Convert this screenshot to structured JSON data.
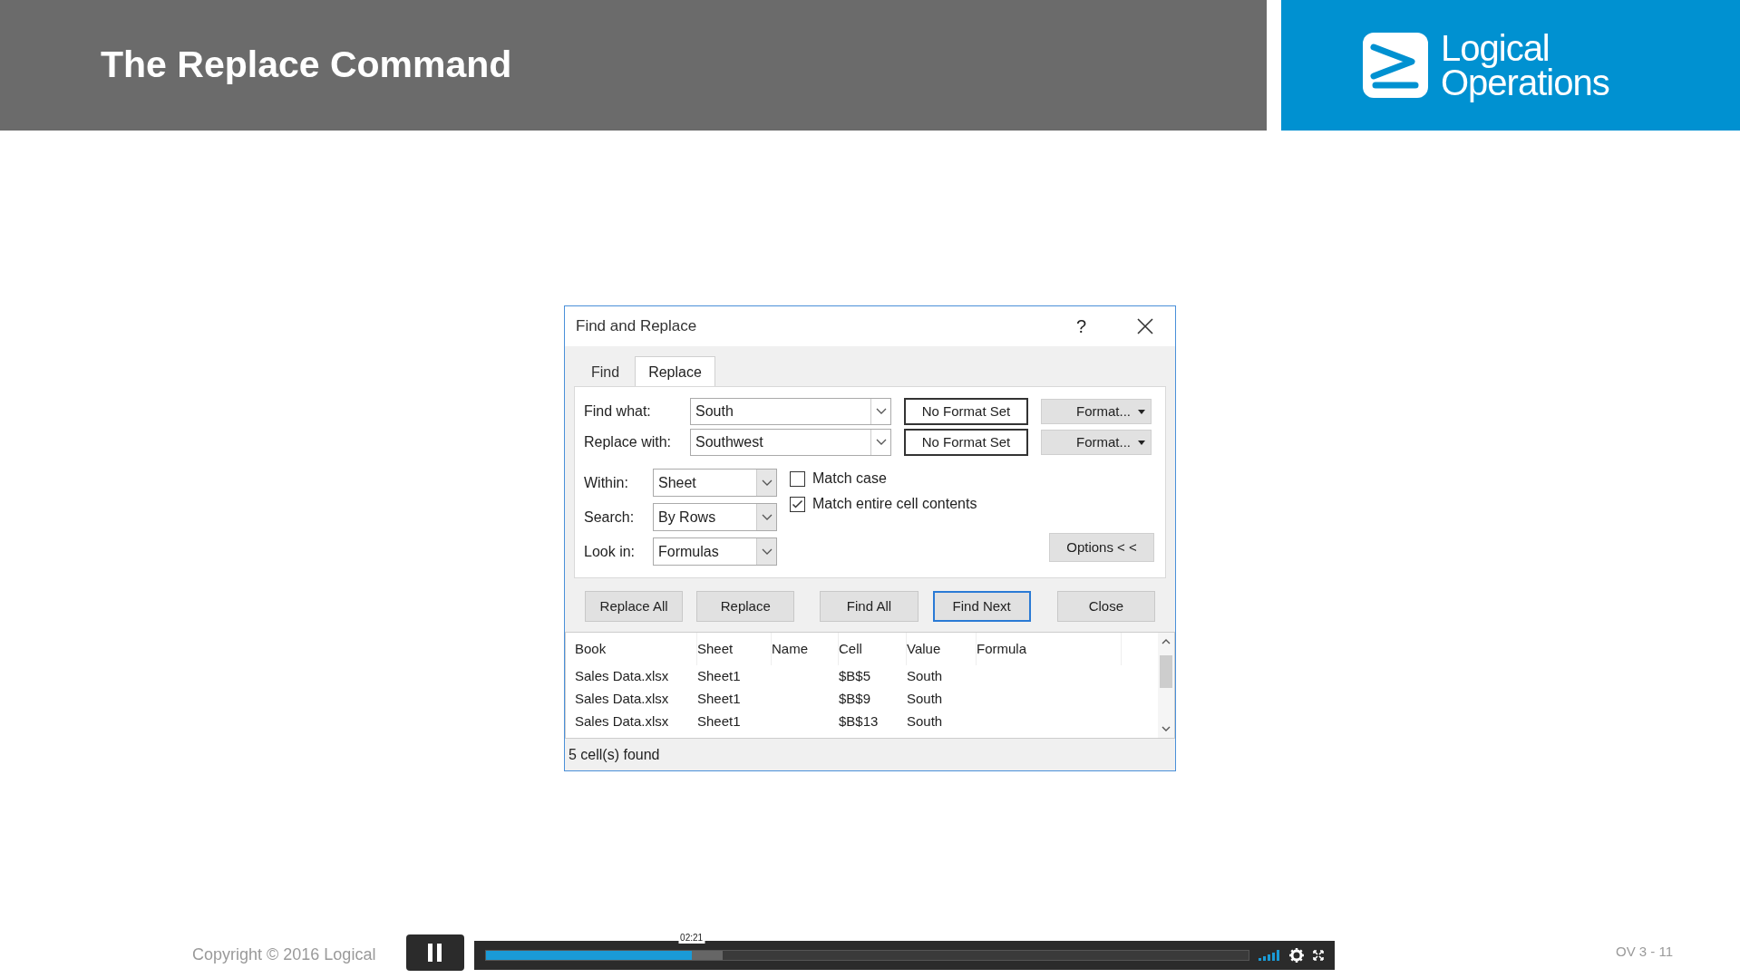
{
  "slide": {
    "title": "The Replace Command",
    "logo_lines": [
      "Logical",
      "Operations"
    ],
    "copyright": "Copyright © 2016 Logical",
    "page": "OV 3 - 11"
  },
  "dialog": {
    "title": "Find and Replace",
    "help": "?",
    "tabs": [
      {
        "label": "Find",
        "selected": false
      },
      {
        "label": "Replace",
        "selected": true
      }
    ],
    "fields": [
      {
        "label": "Find what:",
        "value": "South",
        "format_status": "No Format Set",
        "format_button": "Format..."
      },
      {
        "label": "Replace with:",
        "value": "Southwest",
        "format_status": "No Format Set",
        "format_button": "Format..."
      }
    ],
    "selects": [
      {
        "label": "Within:",
        "value": "Sheet"
      },
      {
        "label": "Search:",
        "value": "By Rows"
      },
      {
        "label": "Look in:",
        "value": "Formulas"
      }
    ],
    "checkboxes": [
      {
        "label": "Match case",
        "checked": false
      },
      {
        "label": "Match entire cell contents",
        "checked": true
      }
    ],
    "options_button": "Options < <",
    "buttons": [
      {
        "label": "Replace All",
        "default": false
      },
      {
        "label": "Replace",
        "default": false
      },
      {
        "label": "Find All",
        "default": false
      },
      {
        "label": "Find Next",
        "default": true
      },
      {
        "label": "Close",
        "default": false
      }
    ],
    "results": {
      "columns": [
        "Book",
        "Sheet",
        "Name",
        "Cell",
        "Value",
        "Formula"
      ],
      "rows": [
        [
          "Sales Data.xlsx",
          "Sheet1",
          "",
          "$B$5",
          "South",
          ""
        ],
        [
          "Sales Data.xlsx",
          "Sheet1",
          "",
          "$B$9",
          "South",
          ""
        ],
        [
          "Sales Data.xlsx",
          "Sheet1",
          "",
          "$B$13",
          "South",
          ""
        ]
      ]
    },
    "status": "5 cell(s) found"
  },
  "player": {
    "playing": true,
    "time": "02:21",
    "level": 0.27,
    "buffer": {
      "level": 0.31
    }
  }
}
